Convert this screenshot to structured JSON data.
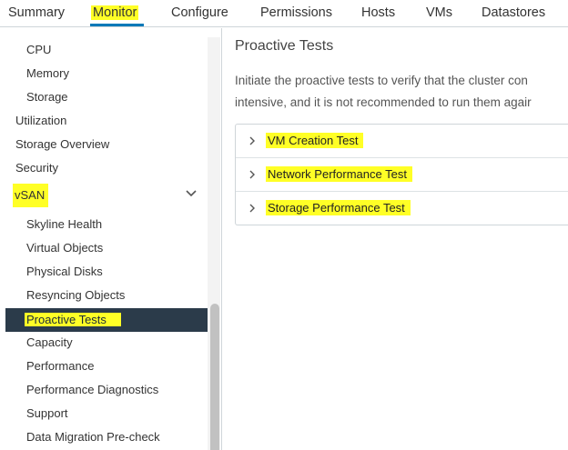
{
  "tabs": [
    {
      "label": "Summary"
    },
    {
      "label": "Monitor"
    },
    {
      "label": "Configure"
    },
    {
      "label": "Permissions"
    },
    {
      "label": "Hosts"
    },
    {
      "label": "VMs"
    },
    {
      "label": "Datastores"
    }
  ],
  "sidebar": {
    "items": [
      {
        "label": "CPU"
      },
      {
        "label": "Memory"
      },
      {
        "label": "Storage"
      },
      {
        "label": "Utilization"
      },
      {
        "label": "Storage Overview"
      },
      {
        "label": "Security"
      },
      {
        "label": "vSAN"
      },
      {
        "label": "Skyline Health"
      },
      {
        "label": "Virtual Objects"
      },
      {
        "label": "Physical Disks"
      },
      {
        "label": "Resyncing Objects"
      },
      {
        "label": "Proactive Tests"
      },
      {
        "label": "Capacity"
      },
      {
        "label": "Performance"
      },
      {
        "label": "Performance Diagnostics"
      },
      {
        "label": "Support"
      },
      {
        "label": "Data Migration Pre-check"
      }
    ]
  },
  "main": {
    "title": "Proactive Tests",
    "description": [
      "Initiate the proactive tests to verify that the cluster con",
      "intensive, and it is not recommended to run them agair"
    ],
    "tests": [
      {
        "label": "VM Creation Test"
      },
      {
        "label": "Network Performance Test"
      },
      {
        "label": "Storage Performance Test"
      }
    ]
  },
  "colors": {
    "highlight": "#ffff26",
    "selected_bg": "#2b3b4a",
    "tab_underline": "#0079b8"
  }
}
